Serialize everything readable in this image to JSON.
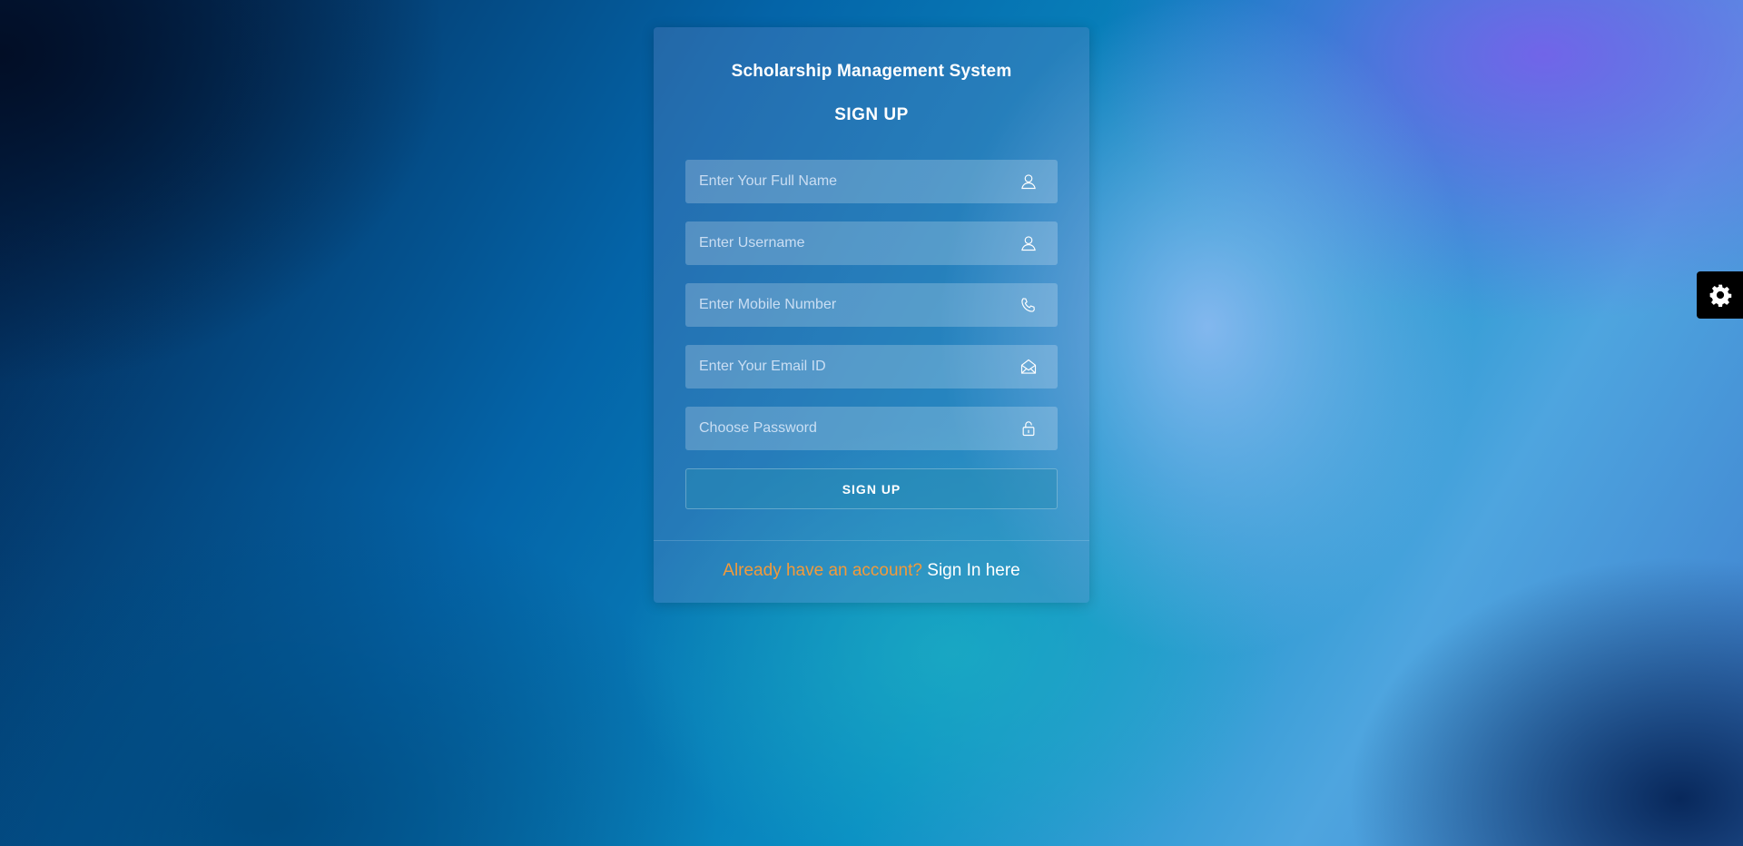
{
  "app": {
    "title": "Scholarship Management System"
  },
  "signup_form": {
    "heading": "SIGN UP",
    "fields": [
      {
        "placeholder": "Enter Your Full Name",
        "value": "",
        "icon": "user-icon"
      },
      {
        "placeholder": "Enter Username",
        "value": "",
        "icon": "user-icon"
      },
      {
        "placeholder": "Enter Mobile Number",
        "value": "",
        "icon": "phone-icon"
      },
      {
        "placeholder": "Enter Your Email ID",
        "value": "",
        "icon": "envelope-open-icon"
      },
      {
        "placeholder": "Choose Password",
        "value": "",
        "icon": "lock-icon"
      }
    ],
    "submit_label": "SIGN UP"
  },
  "footer": {
    "question": "Already have an account?",
    "link_label": "Sign In here"
  },
  "settings": {
    "icon": "gear-icon"
  },
  "colors": {
    "accent_orange": "#f39a3a",
    "text_white": "#ffffff",
    "settings_bg": "#000000"
  }
}
